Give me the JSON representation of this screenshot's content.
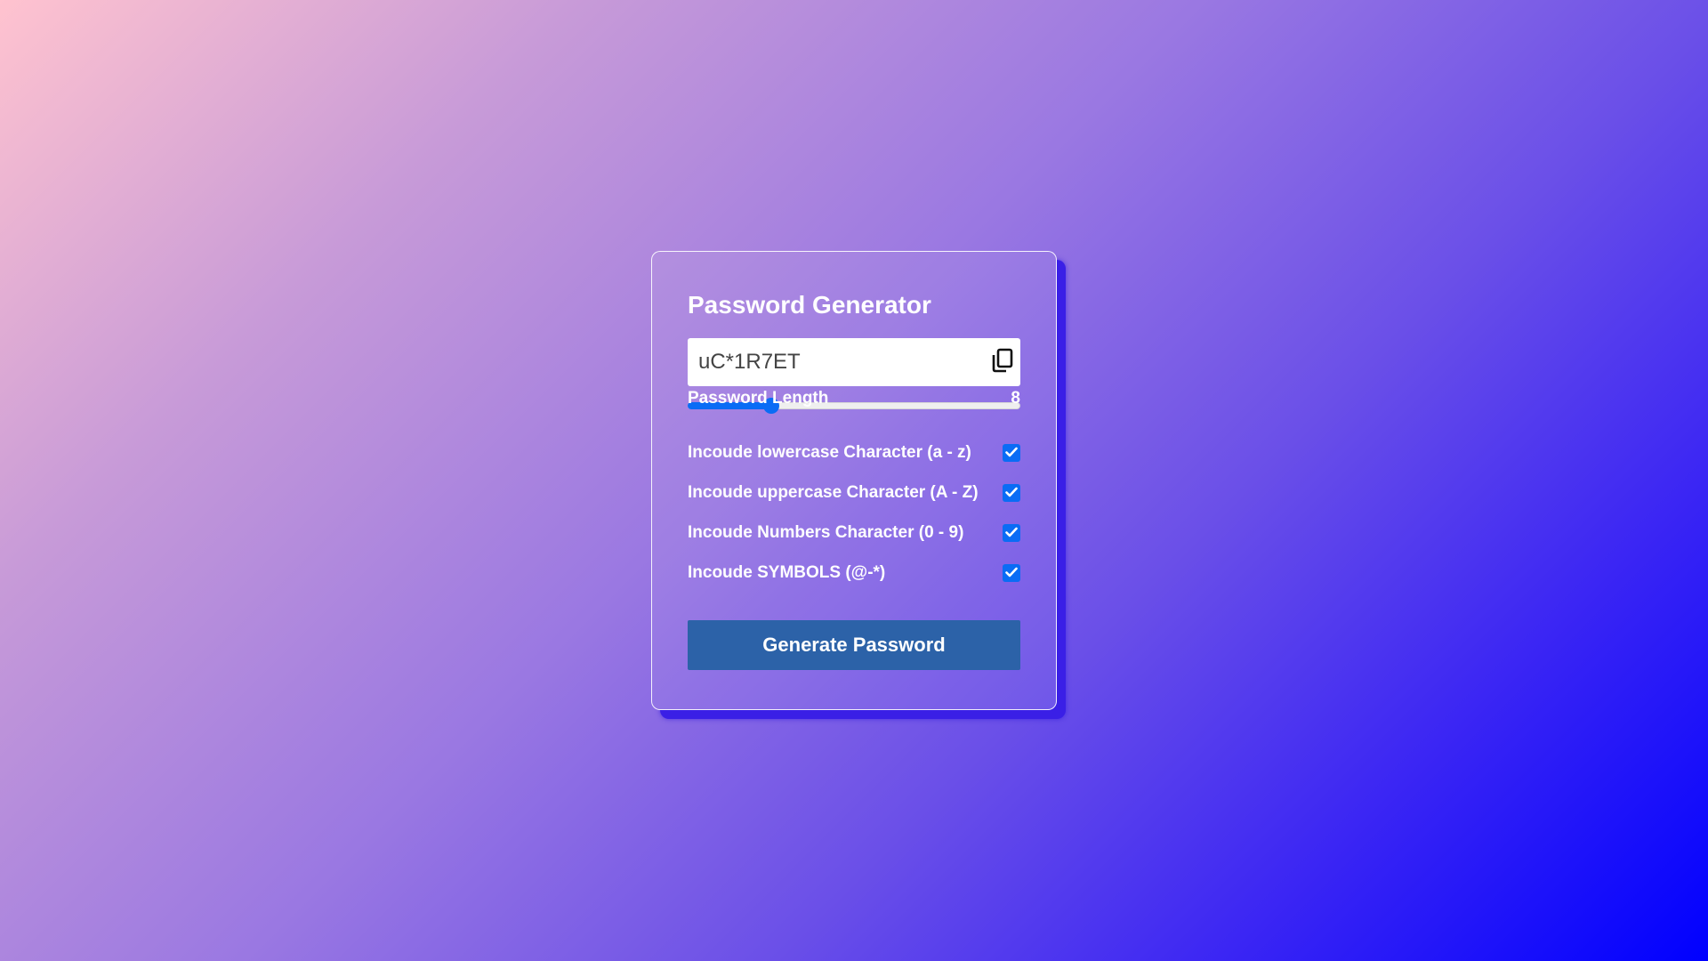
{
  "app": {
    "title": "Password Generator"
  },
  "password": {
    "value": "uC*1R7ET",
    "copy_icon": "copy-icon"
  },
  "length": {
    "label": "Password Length",
    "value": "8",
    "slider_fraction": 0.25
  },
  "options": [
    {
      "label": "Incoude lowercase Character (a - z)",
      "checked": true
    },
    {
      "label": "Incoude uppercase Character (A - Z)",
      "checked": true
    },
    {
      "label": "Incoude Numbers Character (0 - 9)",
      "checked": true
    },
    {
      "label": "Incoude SYMBOLS (@-*)",
      "checked": true
    }
  ],
  "generate_button": {
    "label": "Generate Password"
  },
  "colors": {
    "accent": "#0a6cf5",
    "button": "#2c62a8",
    "text": "#ffffff"
  }
}
